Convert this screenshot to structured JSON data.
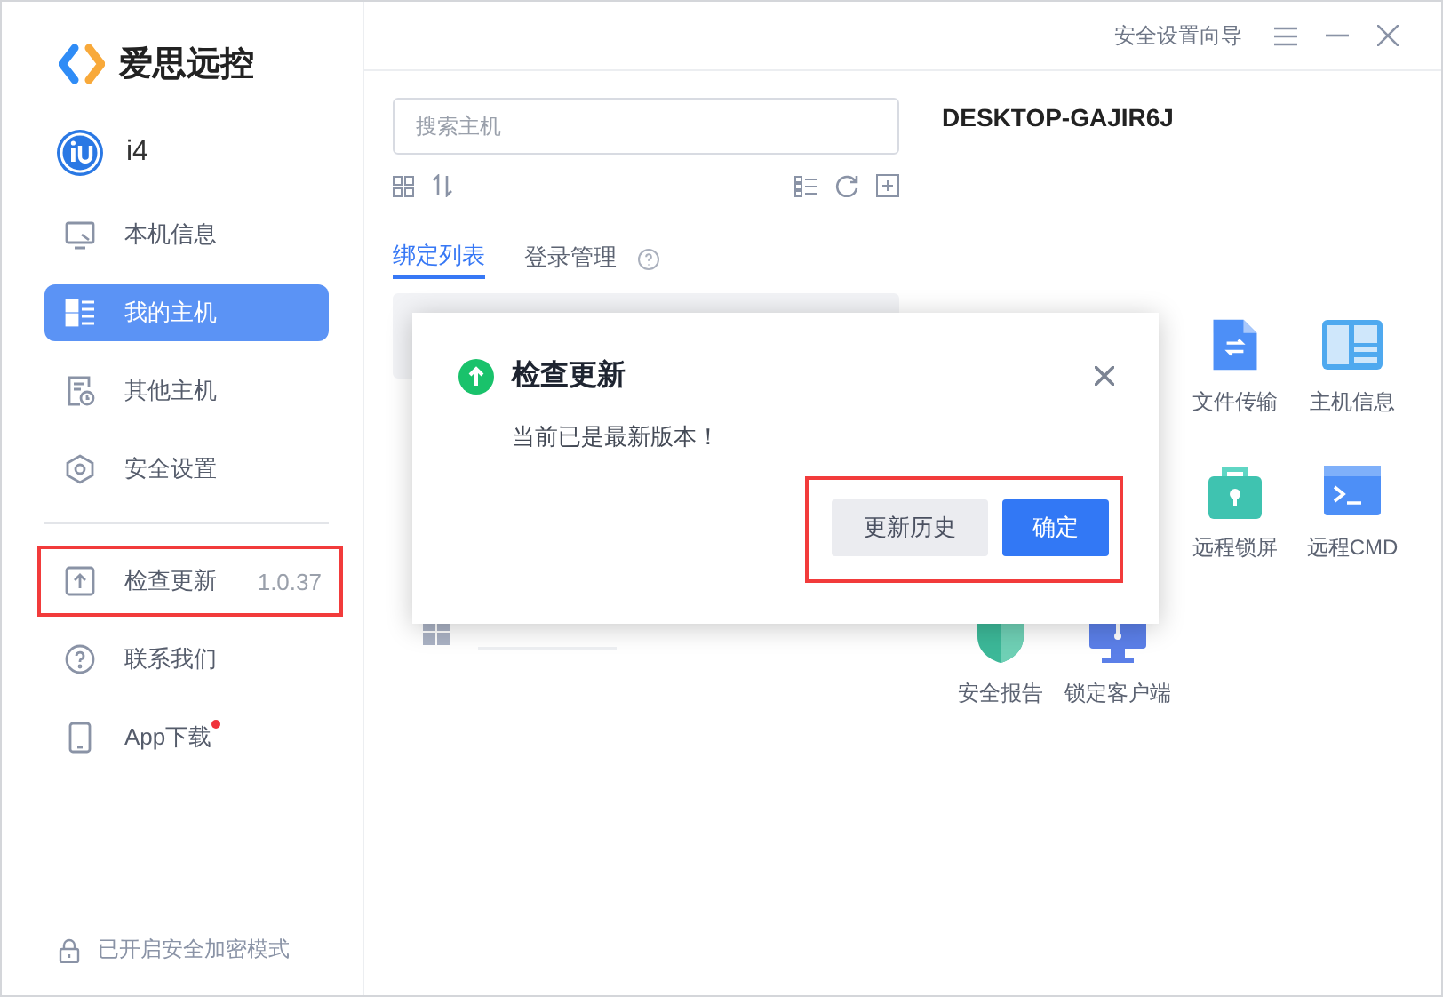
{
  "app": {
    "name": "爱思远控"
  },
  "account": {
    "name": "i4"
  },
  "top_bar": {
    "guide_link": "安全设置向导"
  },
  "sidebar": {
    "items": [
      {
        "label": "本机信息",
        "kind": "monitor",
        "selected": false
      },
      {
        "label": "我的主机",
        "kind": "list",
        "selected": true
      },
      {
        "label": "其他主机",
        "kind": "clock-doc",
        "selected": false
      },
      {
        "label": "安全设置",
        "kind": "hexagon",
        "selected": false
      }
    ],
    "extra_items": [
      {
        "label": "检查更新",
        "kind": "upload",
        "version": "1.0.37",
        "highlighted": true,
        "dot": false
      },
      {
        "label": "联系我们",
        "kind": "question",
        "highlighted": false,
        "dot": false
      },
      {
        "label": "App下载",
        "kind": "phone",
        "highlighted": false,
        "dot": true
      }
    ],
    "footer": "已开启安全加密模式"
  },
  "search": {
    "placeholder": "搜索主机"
  },
  "tabs": [
    {
      "label": "绑定列表",
      "selected": true
    },
    {
      "label": "登录管理",
      "selected": false
    }
  ],
  "detail": {
    "host_name": "DESKTOP-GAJIR6J",
    "tools": [
      {
        "label": "文件传输",
        "kind": "file"
      },
      {
        "label": "主机信息",
        "kind": "info"
      },
      {
        "label": "远程锁屏",
        "kind": "lock"
      },
      {
        "label": "远程CMD",
        "kind": "cmd"
      },
      {
        "label": "安全报告",
        "kind": "shield"
      },
      {
        "label": "锁定客户端",
        "kind": "screen"
      }
    ]
  },
  "dialog": {
    "title": "检查更新",
    "message": "当前已是最新版本！",
    "buttons": [
      {
        "label": "更新历史",
        "kind": "secondary"
      },
      {
        "label": "确定",
        "kind": "primary"
      }
    ],
    "buttons_highlighted": true
  }
}
